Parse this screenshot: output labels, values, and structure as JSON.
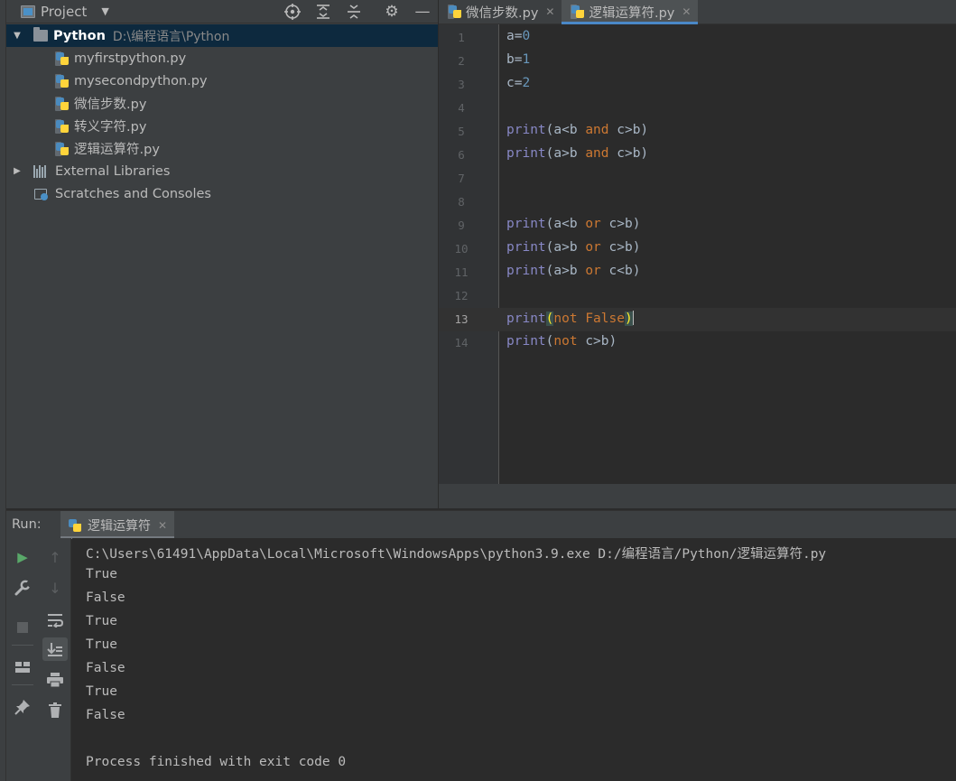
{
  "project_panel": {
    "title": "Project",
    "tools": [
      "locate-icon",
      "expand-all-icon",
      "collapse-all-icon",
      "gear-icon",
      "minimize-icon"
    ],
    "tree": {
      "root": {
        "name": "Python",
        "path": "D:\\编程语言\\Python"
      },
      "files": [
        "myfirstpython.py",
        "mysecondpython.py",
        "微信步数.py",
        "转义字符.py",
        "逻辑运算符.py"
      ],
      "external_libraries": "External Libraries",
      "scratches": "Scratches and Consoles"
    }
  },
  "editor": {
    "tabs": [
      {
        "label": "微信步数.py",
        "active": false
      },
      {
        "label": "逻辑运算符.py",
        "active": true
      }
    ],
    "current_line": 13,
    "line_numbers": [
      "1",
      "2",
      "3",
      "4",
      "5",
      "6",
      "7",
      "8",
      "9",
      "10",
      "11",
      "12",
      "13",
      "14"
    ],
    "lines": [
      "a=0",
      "b=1",
      "c=2",
      "",
      "print(a<b and c>b)",
      "print(a>b and c>b)",
      "",
      "",
      "print(a<b or c>b)",
      "print(a>b or c>b)",
      "print(a>b or c<b)",
      "",
      "print(not False)",
      "print(not c>b)"
    ]
  },
  "run_panel": {
    "label": "Run:",
    "tab_label": "逻辑运算符",
    "command": "C:\\Users\\61491\\AppData\\Local\\Microsoft\\WindowsApps\\python3.9.exe D:/编程语言/Python/逻辑运算符.py",
    "output": [
      "True",
      "False",
      "True",
      "True",
      "False",
      "True",
      "False"
    ],
    "exit_message": "Process finished with exit code 0"
  },
  "colors": {
    "keyword": "#cc7832",
    "builtin": "#8888c6",
    "number": "#6897bb",
    "selection": "#0d293e",
    "accent": "#4a88c7"
  }
}
